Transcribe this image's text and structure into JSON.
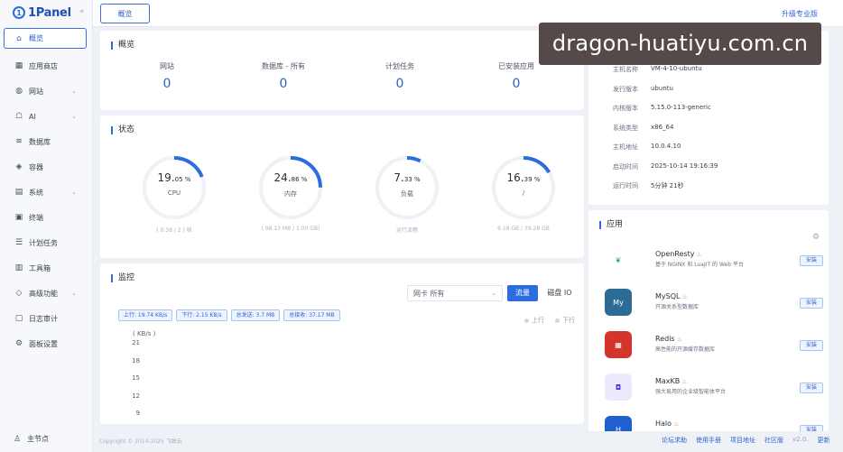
{
  "app": {
    "logo_text": "1Panel",
    "logo_mark": "1"
  },
  "sidebar": {
    "items": [
      {
        "label": "概览",
        "icon": "home-icon",
        "glyph": "⌂"
      },
      {
        "label": "应用商店",
        "icon": "apps-icon",
        "glyph": "▦"
      },
      {
        "label": "网站",
        "icon": "globe-icon",
        "glyph": "◍"
      },
      {
        "label": "AI",
        "icon": "robot-icon",
        "glyph": "☖"
      },
      {
        "label": "数据库",
        "icon": "database-icon",
        "glyph": "≋"
      },
      {
        "label": "容器",
        "icon": "container-icon",
        "glyph": "◈"
      },
      {
        "label": "系统",
        "icon": "system-icon",
        "glyph": "▤"
      },
      {
        "label": "终端",
        "icon": "terminal-icon",
        "glyph": "▣"
      },
      {
        "label": "计划任务",
        "icon": "task-icon",
        "glyph": "☰"
      },
      {
        "label": "工具箱",
        "icon": "toolbox-icon",
        "glyph": "▥"
      },
      {
        "label": "高级功能",
        "icon": "diamond-icon",
        "glyph": "◇"
      },
      {
        "label": "日志审计",
        "icon": "log-icon",
        "glyph": "▢"
      },
      {
        "label": "面板设置",
        "icon": "gear-icon",
        "glyph": "⚙"
      }
    ],
    "footer_label": "主节点",
    "footer_glyph": "♙"
  },
  "topbar": {
    "tab": "概览",
    "pro": "升级专业版"
  },
  "overview": {
    "title": "概览",
    "items": [
      {
        "label": "网站",
        "value": "0"
      },
      {
        "label": "数据库 - 所有",
        "value": "0"
      },
      {
        "label": "计划任务",
        "value": "0"
      },
      {
        "label": "已安装应用",
        "value": "0"
      }
    ]
  },
  "status": {
    "title": "状态",
    "gauges": [
      {
        "value": "19.",
        "decimals": "05 %",
        "label": "CPU",
        "percent": 19.05,
        "sub": "( 0.38 / 2 ) 核"
      },
      {
        "value": "24.",
        "decimals": "86 %",
        "label": "内存",
        "percent": 24.86,
        "sub": "( 98.13 MB / 1.00 GB)"
      },
      {
        "value": "7.",
        "decimals": "33 %",
        "label": "负载",
        "percent": 7.33,
        "sub": "运行流畅"
      },
      {
        "value": "16.",
        "decimals": "39 %",
        "label": "/",
        "percent": 16.39,
        "sub": "6.18 GB / 39.28 GB"
      }
    ],
    "accent": "#2d6cdf"
  },
  "monitor": {
    "title": "监控",
    "nic_select": "网卡  所有",
    "tab_flow": "流量",
    "tab_io": "磁盘 IO",
    "chips": [
      "上行: 19.74 KB/s",
      "下行: 2.15 KB/s",
      "总发送: 3.7 MB",
      "总接收: 37.17 MB"
    ],
    "legend": {
      "up": "上行",
      "down": "下行"
    },
    "y_unit": "( KB/s )",
    "y_ticks": [
      "21",
      "18",
      "15",
      "12",
      "9"
    ]
  },
  "sysinfo": {
    "rows": [
      {
        "key": "主机名称",
        "value": "VM-4-10-ubuntu"
      },
      {
        "key": "发行版本",
        "value": "ubuntu"
      },
      {
        "key": "内核版本",
        "value": "5.15.0-113-generic"
      },
      {
        "key": "系统类型",
        "value": "x86_64"
      },
      {
        "key": "主机地址",
        "value": "10.0.4.10"
      },
      {
        "key": "启动时间",
        "value": "2025-10-14 19:16:39"
      },
      {
        "key": "运行时间",
        "value": "5分钟 21秒"
      }
    ]
  },
  "apps": {
    "title": "应用",
    "install_label": "安装",
    "items": [
      {
        "name": "OpenResty",
        "desc": "基于 NGINX 和 LuaJIT 的 Web 平台",
        "icon": "openresty-icon",
        "color": "#ffffff",
        "glyph": "❦",
        "glyph_color": "#3aa655"
      },
      {
        "name": "MySQL",
        "desc": "开源关系型数据库",
        "icon": "mysql-icon",
        "color": "#2c6b96",
        "glyph": "My",
        "glyph_color": "#ffffff"
      },
      {
        "name": "Redis",
        "desc": "高性能的开源缓存数据库",
        "icon": "redis-icon",
        "color": "#d3352c",
        "glyph": "▦",
        "glyph_color": "#ffffff"
      },
      {
        "name": "MaxKB",
        "desc": "强大易用的企业级智能体平台",
        "icon": "maxkb-icon",
        "color": "#ece9ff",
        "glyph": "◘",
        "glyph_color": "#4a3fd1"
      },
      {
        "name": "Halo",
        "desc": "",
        "icon": "halo-icon",
        "color": "#1f5fd1",
        "glyph": "H",
        "glyph_color": "#ffffff"
      }
    ]
  },
  "footer": {
    "copyright": "Copyright © 2014-2025 飞致云",
    "links": [
      "论坛求助",
      "使用手册",
      "项目地址",
      "社区版"
    ],
    "version": "v2.0.",
    "update": "更新"
  },
  "watermark": "dragon-huatiyu.com.cn"
}
